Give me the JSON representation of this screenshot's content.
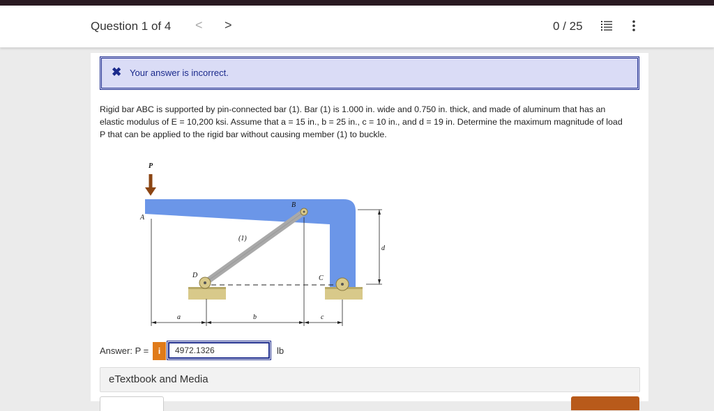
{
  "header": {
    "question_label": "Question 1 of 4",
    "prev_glyph": "<",
    "next_glyph": ">",
    "score": "0 / 25"
  },
  "feedback": {
    "icon": "x-icon",
    "message": "Your answer is incorrect."
  },
  "problem": {
    "line1": "Rigid bar ABC is supported by pin-connected bar (1). Bar (1) is 1.000 in. wide and 0.750 in. thick, and made of aluminum that has an",
    "line2": "elastic modulus of E = 10,200 ksi. Assume that a = 15 in., b = 25 in., c = 10 in., and d = 19 in. Determine the maximum magnitude of load",
    "line3": "P that can be applied to the rigid bar without causing member (1) to buckle."
  },
  "diagram": {
    "label_P": "P",
    "label_A": "A",
    "label_B": "B",
    "label_C": "C",
    "label_D": "D",
    "label_member": "(1)",
    "label_a": "a",
    "label_b": "b",
    "label_c": "c",
    "label_d": "d",
    "bar_color": "#6b96e8",
    "member_color": "#a9a9a9",
    "support_color": "#d8c98a",
    "load_color": "#8b4513"
  },
  "answer": {
    "label": "Answer: P =",
    "info_glyph": "i",
    "value": "4972.1326",
    "unit": "lb"
  },
  "etextbook": {
    "label": "eTextbook and Media"
  },
  "colors": {
    "accent": "#1b2a8c",
    "feedback_bg": "#dadcf6",
    "info_button": "#e07b1a"
  }
}
